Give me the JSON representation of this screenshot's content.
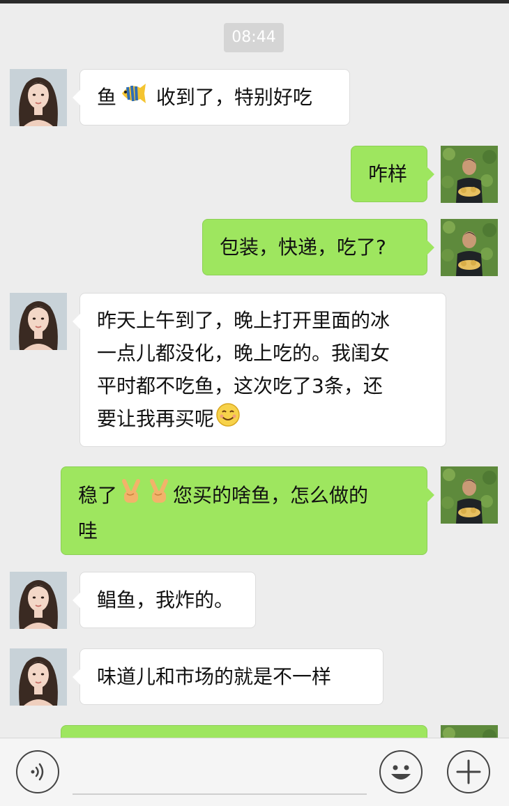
{
  "chat": {
    "timestamp": "08:44",
    "messages": [
      {
        "side": "in",
        "text_before": "鱼",
        "emoji": "tropical-fish",
        "text_after": " 收到了，特别好吃"
      },
      {
        "side": "out",
        "text": "咋样"
      },
      {
        "side": "out",
        "text": "包装，快递，吃了?"
      },
      {
        "side": "in",
        "lines": [
          "昨天上午到了，晚上打开里面的冰",
          "一点儿都没化，晚上吃的。我闺女",
          "平时都不吃鱼，这次吃了3条，还",
          "要让我再买呢"
        ],
        "emoji": "smile"
      },
      {
        "side": "out",
        "text_before": "稳了",
        "emoji": "victory-hand x2",
        "text_after": "您买的啥鱼，怎么做的",
        "line2": "哇"
      },
      {
        "side": "in",
        "text": "鲳鱼，我炸的。"
      },
      {
        "side": "in",
        "text": "味道儿和市场的就是不一样"
      }
    ]
  },
  "input_bar": {
    "icons": [
      "voice-icon",
      "emoji-icon",
      "plus-icon"
    ],
    "placeholder": ""
  },
  "colors": {
    "background": "#ededed",
    "outgoing_bubble": "#9ee65f",
    "incoming_bubble": "#ffffff",
    "timestamp_bg": "#d5d5d5"
  }
}
